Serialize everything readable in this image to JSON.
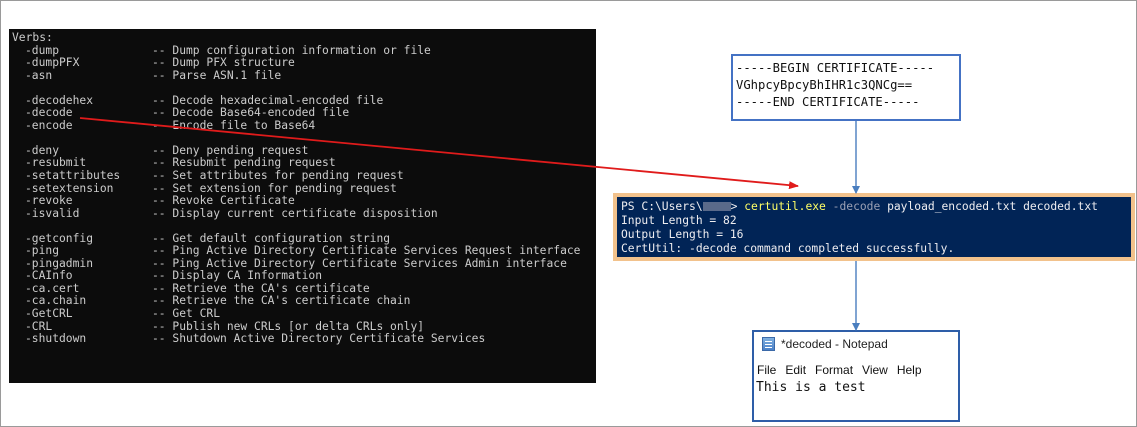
{
  "cmd_window": {
    "header": "Verbs:",
    "groups": [
      [
        {
          "verb": "-dump",
          "desc": "-- Dump configuration information or file"
        },
        {
          "verb": "-dumpPFX",
          "desc": "-- Dump PFX structure"
        },
        {
          "verb": "-asn",
          "desc": "-- Parse ASN.1 file"
        }
      ],
      [
        {
          "verb": "-decodehex",
          "desc": "-- Decode hexadecimal-encoded file"
        },
        {
          "verb": "-decode",
          "desc": "-- Decode Base64-encoded file"
        },
        {
          "verb": "-encode",
          "desc": "-- Encode file to Base64"
        }
      ],
      [
        {
          "verb": "-deny",
          "desc": "-- Deny pending request"
        },
        {
          "verb": "-resubmit",
          "desc": "-- Resubmit pending request"
        },
        {
          "verb": "-setattributes",
          "desc": "-- Set attributes for pending request"
        },
        {
          "verb": "-setextension",
          "desc": "-- Set extension for pending request"
        },
        {
          "verb": "-revoke",
          "desc": "-- Revoke Certificate"
        },
        {
          "verb": "-isvalid",
          "desc": "-- Display current certificate disposition"
        }
      ],
      [
        {
          "verb": "-getconfig",
          "desc": "-- Get default configuration string"
        },
        {
          "verb": "-ping",
          "desc": "-- Ping Active Directory Certificate Services Request interface"
        },
        {
          "verb": "-pingadmin",
          "desc": "-- Ping Active Directory Certificate Services Admin interface"
        },
        {
          "verb": "-CAInfo",
          "desc": "-- Display CA Information"
        },
        {
          "verb": "-ca.cert",
          "desc": "-- Retrieve the CA's certificate"
        },
        {
          "verb": "-ca.chain",
          "desc": "-- Retrieve the CA's certificate chain"
        },
        {
          "verb": "-GetCRL",
          "desc": "-- Get CRL"
        },
        {
          "verb": "-CRL",
          "desc": "-- Publish new CRLs [or delta CRLs only]"
        },
        {
          "verb": "-shutdown",
          "desc": "-- Shutdown Active Directory Certificate Services"
        }
      ]
    ]
  },
  "certificate": {
    "begin": "-----BEGIN CERTIFICATE-----",
    "body": "VGhpcyBpcyBhIHR1c3QNCg==",
    "end": "-----END CERTIFICATE-----"
  },
  "powershell": {
    "prompt_prefix": "PS C:\\Users\\",
    "prompt_suffix": "> ",
    "command": "certutil.exe",
    "flag": "-decode",
    "args": " payload_encoded.txt decoded.txt",
    "line2": "Input Length = 82",
    "line3": "Output Length = 16",
    "line4": "CertUtil: -decode command completed successfully."
  },
  "notepad": {
    "title": "*decoded - Notepad",
    "menu": [
      "File",
      "Edit",
      "Format",
      "View",
      "Help"
    ],
    "content": "This is a test"
  },
  "colors": {
    "arrow_red": "#e01b1b",
    "arrow_blue": "#4a7ebf"
  }
}
